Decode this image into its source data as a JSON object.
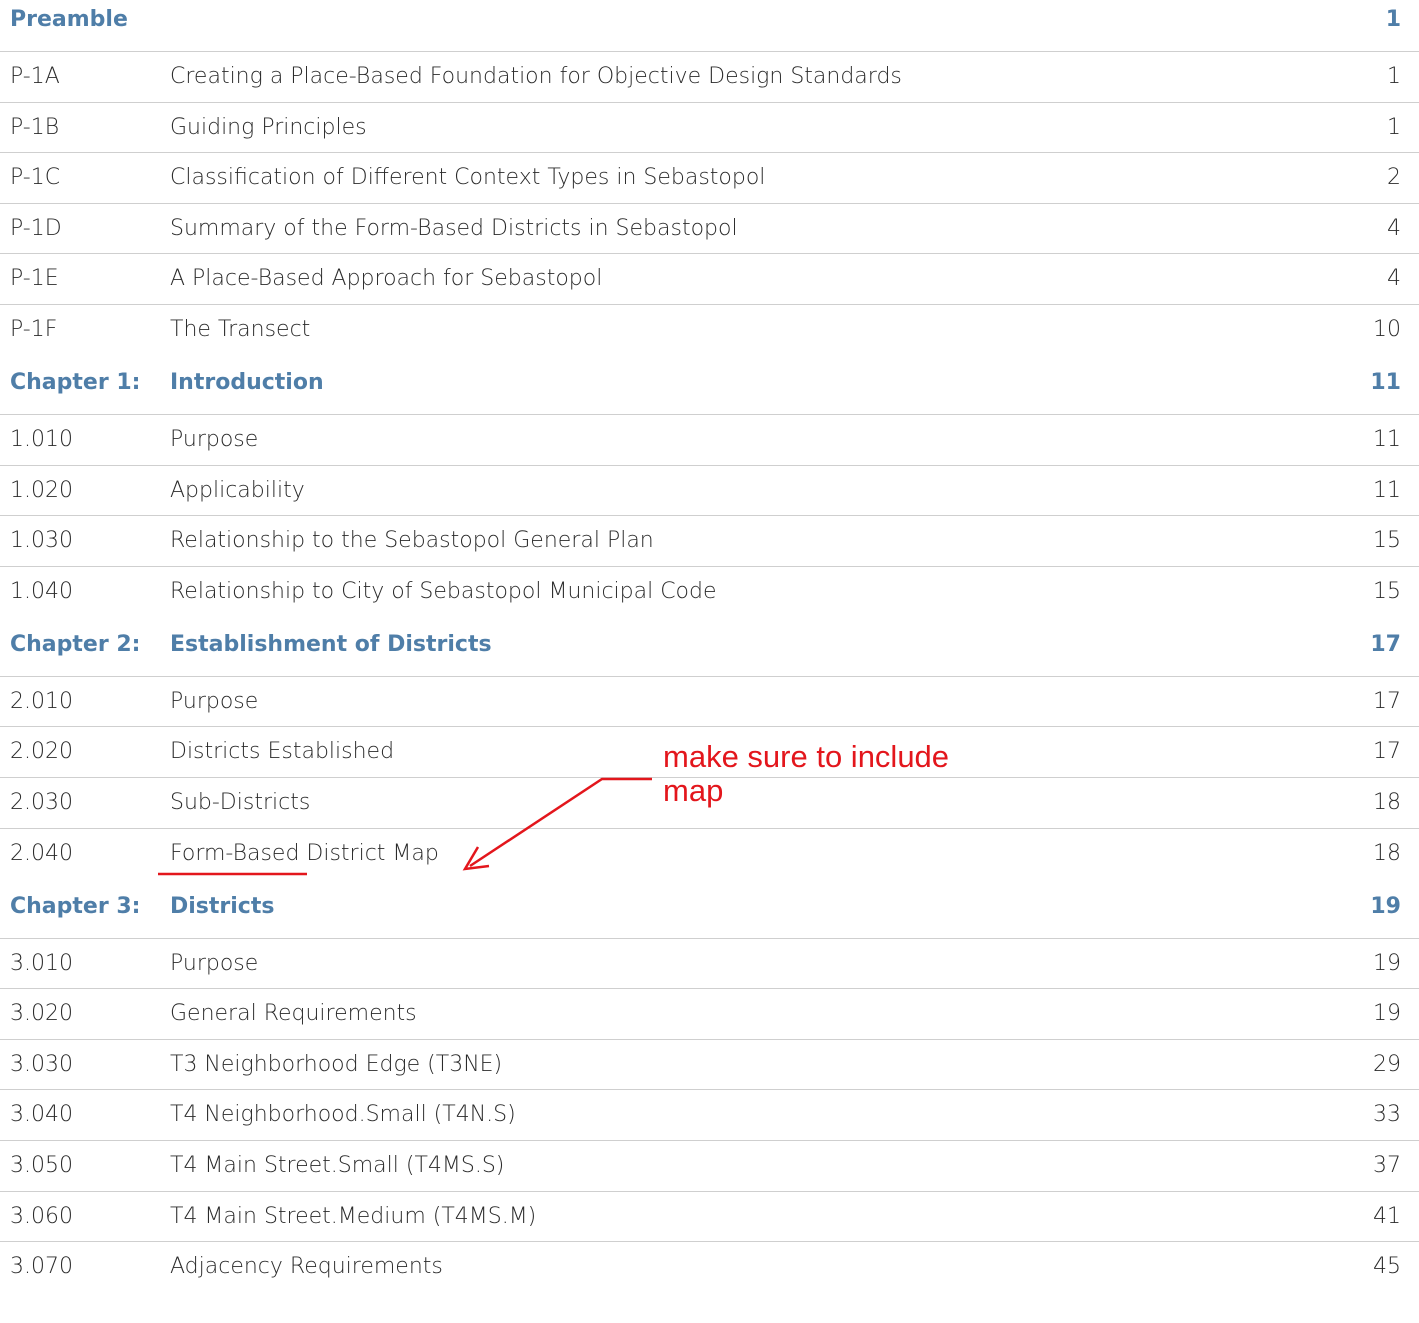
{
  "sections": [
    {
      "code": "Preamble",
      "title": "",
      "page": "1",
      "entries": [
        {
          "code": "P-1A",
          "title": "Creating a Place-Based Foundation for Objective Design Standards",
          "page": "1"
        },
        {
          "code": "P-1B",
          "title": "Guiding Principles",
          "page": "1"
        },
        {
          "code": "P-1C",
          "title": "Classification of Different Context Types in Sebastopol",
          "page": "2"
        },
        {
          "code": "P-1D",
          "title": "Summary of the Form-Based Districts in Sebastopol",
          "page": "4"
        },
        {
          "code": "P-1E",
          "title": "A Place-Based Approach for Sebastopol",
          "page": "4"
        },
        {
          "code": "P-1F",
          "title": "The Transect",
          "page": "10"
        }
      ]
    },
    {
      "code": "Chapter 1:",
      "title": "Introduction",
      "page": "11",
      "entries": [
        {
          "code": "1.010",
          "title": "Purpose",
          "page": "11"
        },
        {
          "code": "1.020",
          "title": "Applicability",
          "page": "11"
        },
        {
          "code": "1.030",
          "title": "Relationship to the Sebastopol General Plan",
          "page": "15"
        },
        {
          "code": "1.040",
          "title": "Relationship to City of Sebastopol Municipal Code",
          "page": "15"
        }
      ]
    },
    {
      "code": "Chapter 2:",
      "title": "Establishment of Districts",
      "page": "17",
      "entries": [
        {
          "code": "2.010",
          "title": "Purpose",
          "page": "17"
        },
        {
          "code": "2.020",
          "title": "Districts Established",
          "page": "17"
        },
        {
          "code": "2.030",
          "title": "Sub-Districts",
          "page": "18"
        },
        {
          "code": "2.040",
          "title": "Form-Based District Map",
          "page": "18"
        }
      ]
    },
    {
      "code": "Chapter 3:",
      "title": "Districts",
      "page": "19",
      "entries": [
        {
          "code": "3.010",
          "title": "Purpose",
          "page": "19"
        },
        {
          "code": "3.020",
          "title": "General Requirements",
          "page": "19"
        },
        {
          "code": "3.030",
          "title": "T3 Neighborhood Edge (T3NE)",
          "page": "29"
        },
        {
          "code": "3.040",
          "title": "T4 Neighborhood.Small (T4N.S)",
          "page": "33"
        },
        {
          "code": "3.050",
          "title": "T4 Main Street.Small (T4MS.S)",
          "page": "37"
        },
        {
          "code": "3.060",
          "title": "T4 Main Street.Medium (T4MS.M)",
          "page": "41"
        },
        {
          "code": "3.070",
          "title": "Adjacency Requirements",
          "page": "45"
        }
      ]
    }
  ],
  "annotation": {
    "text": "make sure to include\nmap",
    "color": "#e3161c"
  },
  "colors": {
    "heading": "#4f7ea8",
    "body_text": "#2b2b2b",
    "rule": "#cfcfcf",
    "markup": "#e3161c"
  }
}
